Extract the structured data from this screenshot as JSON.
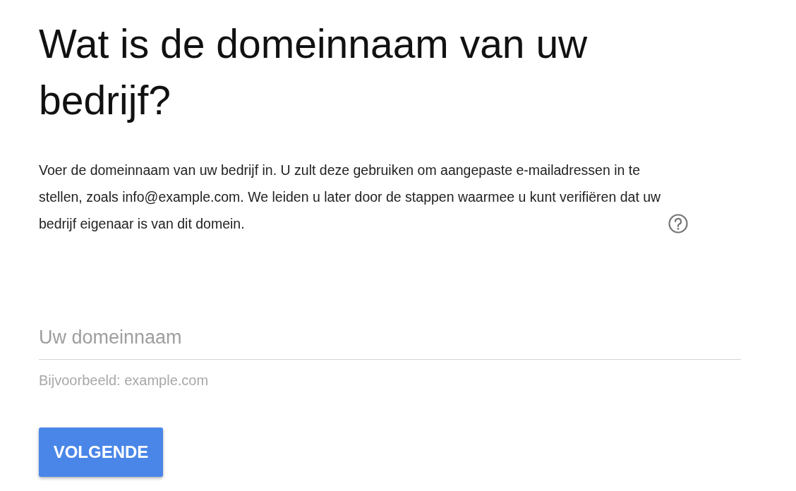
{
  "heading": "Wat is de domeinnaam van uw bedrijf?",
  "description": "Voer de domeinnaam van uw bedrijf in. U zult deze gebruiken om aangepaste e-mailadressen in te stellen, zoals info@example.com. We leiden u later door de stappen waarmee u kunt verifiëren dat uw bedrijf eigenaar is van dit domein.",
  "domain_field": {
    "placeholder": "Uw domeinnaam",
    "hint": "Bijvoorbeeld: example.com"
  },
  "buttons": [
    {
      "label": "VOLGENDE"
    }
  ]
}
